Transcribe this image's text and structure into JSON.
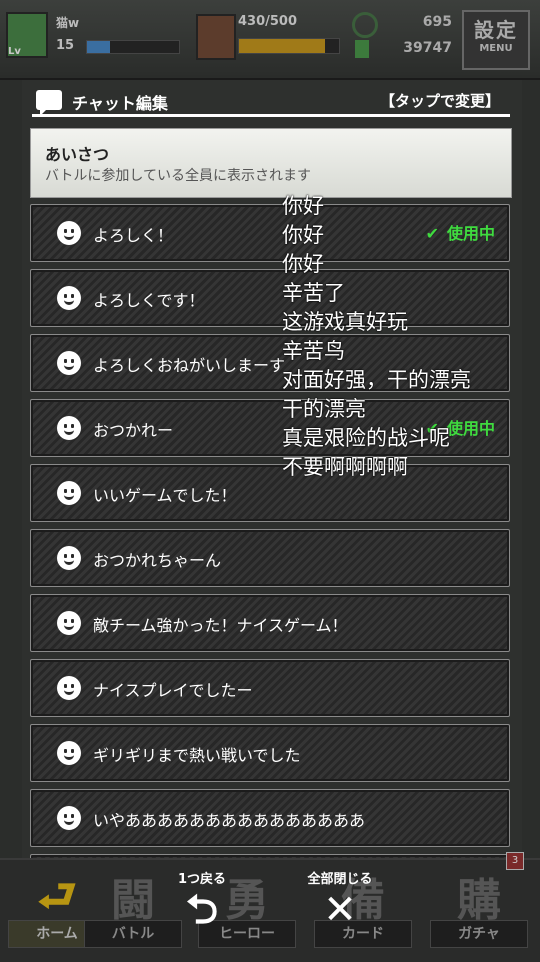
{
  "status": {
    "player_name": "猫w",
    "player_level": "15",
    "level_badge": "Lv",
    "xp_fraction": 0.25,
    "stamina": "430/500",
    "stamina_fraction": 0.86,
    "coins": "695",
    "gems": "39747",
    "settings_label": "設定",
    "menu_label": "MENU"
  },
  "dialog": {
    "title": "チャット編集",
    "tap_to_change": "【タップで変更】",
    "category_title": "あいさつ",
    "category_subtitle": "バトルに参加している全員に表示されます",
    "in_use_label": "使用中",
    "items": [
      {
        "label": "よろしく！",
        "in_use": true
      },
      {
        "label": "よろしくです！",
        "in_use": false
      },
      {
        "label": "よろしくおねがいしまーす",
        "in_use": false
      },
      {
        "label": "おつかれー",
        "in_use": true
      },
      {
        "label": "いいゲームでした！",
        "in_use": false
      },
      {
        "label": "おつかれちゃーん",
        "in_use": false
      },
      {
        "label": "敵チーム強かった！ナイスゲーム！",
        "in_use": false
      },
      {
        "label": "ナイスプレイでしたー",
        "in_use": false
      },
      {
        "label": "ギリギリまで熱い戦いでした",
        "in_use": false
      },
      {
        "label": "いやあああああああああああああああ",
        "in_use": false
      }
    ]
  },
  "overlay_lines": [
    "你好",
    "你好",
    "你好",
    "辛苦了",
    "这游戏真好玩",
    "辛苦鸟",
    "对面好强，干的漂亮",
    "干的漂亮",
    "真是艰险的战斗呢",
    "不要啊啊啊啊"
  ],
  "controls": {
    "back_label": "1つ戻る",
    "close_all_label": "全部閉じる"
  },
  "nav": {
    "home": "ホーム",
    "battle": "バトル",
    "hero": "ヒーロー",
    "card": "カード",
    "gacha": "ガチャ",
    "glyph_battle": "闘",
    "glyph_hero": "勇",
    "glyph_card": "備",
    "glyph_gacha": "購",
    "gacha_badge": "3"
  },
  "colors": {
    "in_use_green": "#3fdb3f",
    "home_accent": "#b79512"
  }
}
